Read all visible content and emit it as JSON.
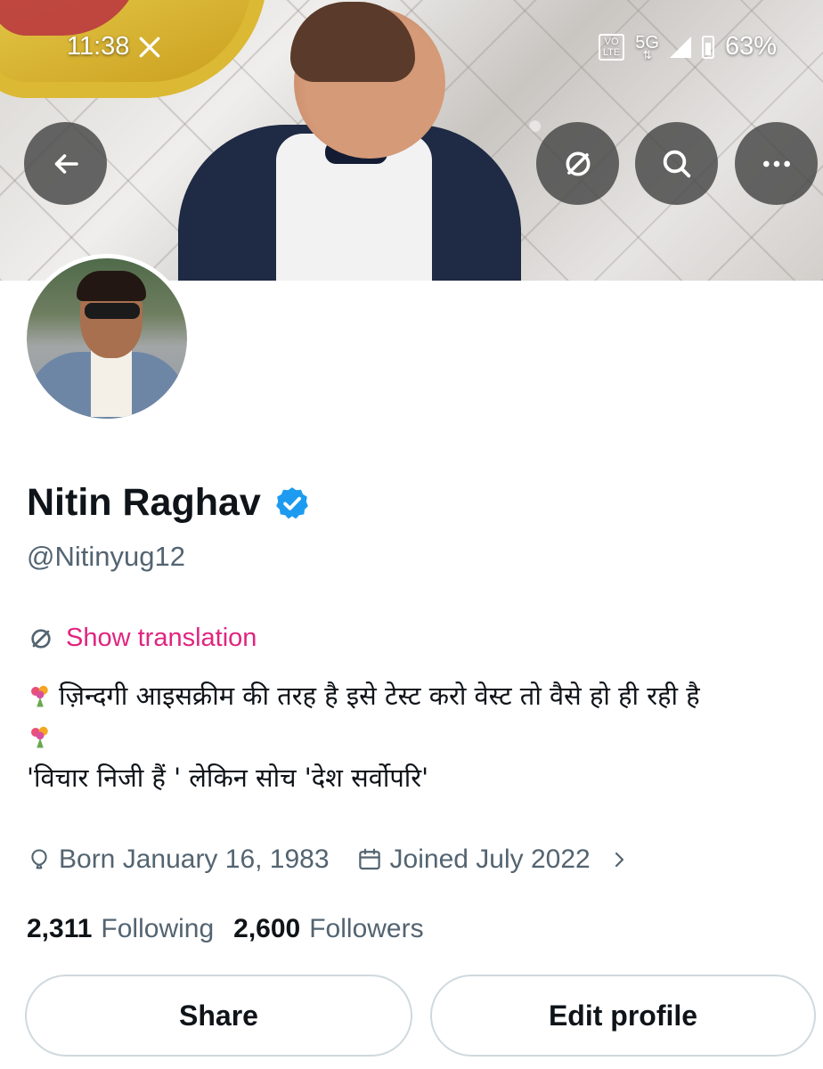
{
  "status_bar": {
    "time": "11:38",
    "volte_top": "VO",
    "volte_bottom": "LTE",
    "network": "5G",
    "battery": "63%"
  },
  "header": {
    "back_icon": "arrow-left-icon",
    "translate_icon": "translate-icon",
    "search_icon": "search-icon",
    "more_icon": "more-horizontal-icon"
  },
  "profile": {
    "name": "Nitin Raghav",
    "handle": "@Nitinyug12",
    "verified": true,
    "show_translation": "Show translation",
    "bio_line1": "ज़िन्दगी आइसक्रीम की तरह है इसे टेस्ट करो वेस्ट तो वैसे हो ही रही है",
    "bio_line2": "'विचार निजी हैं ' लेकिन सोच 'देश सर्वोपरि'",
    "born": "Born January 16, 1983",
    "joined": "Joined July 2022",
    "following_count": "2,311",
    "following_label": "Following",
    "followers_count": "2,600",
    "followers_label": "Followers"
  },
  "actions": {
    "share": "Share",
    "edit_profile": "Edit profile"
  },
  "colors": {
    "accent_pink": "#e0257f",
    "verified_blue": "#1d9bf0",
    "secondary_text": "#536471"
  }
}
